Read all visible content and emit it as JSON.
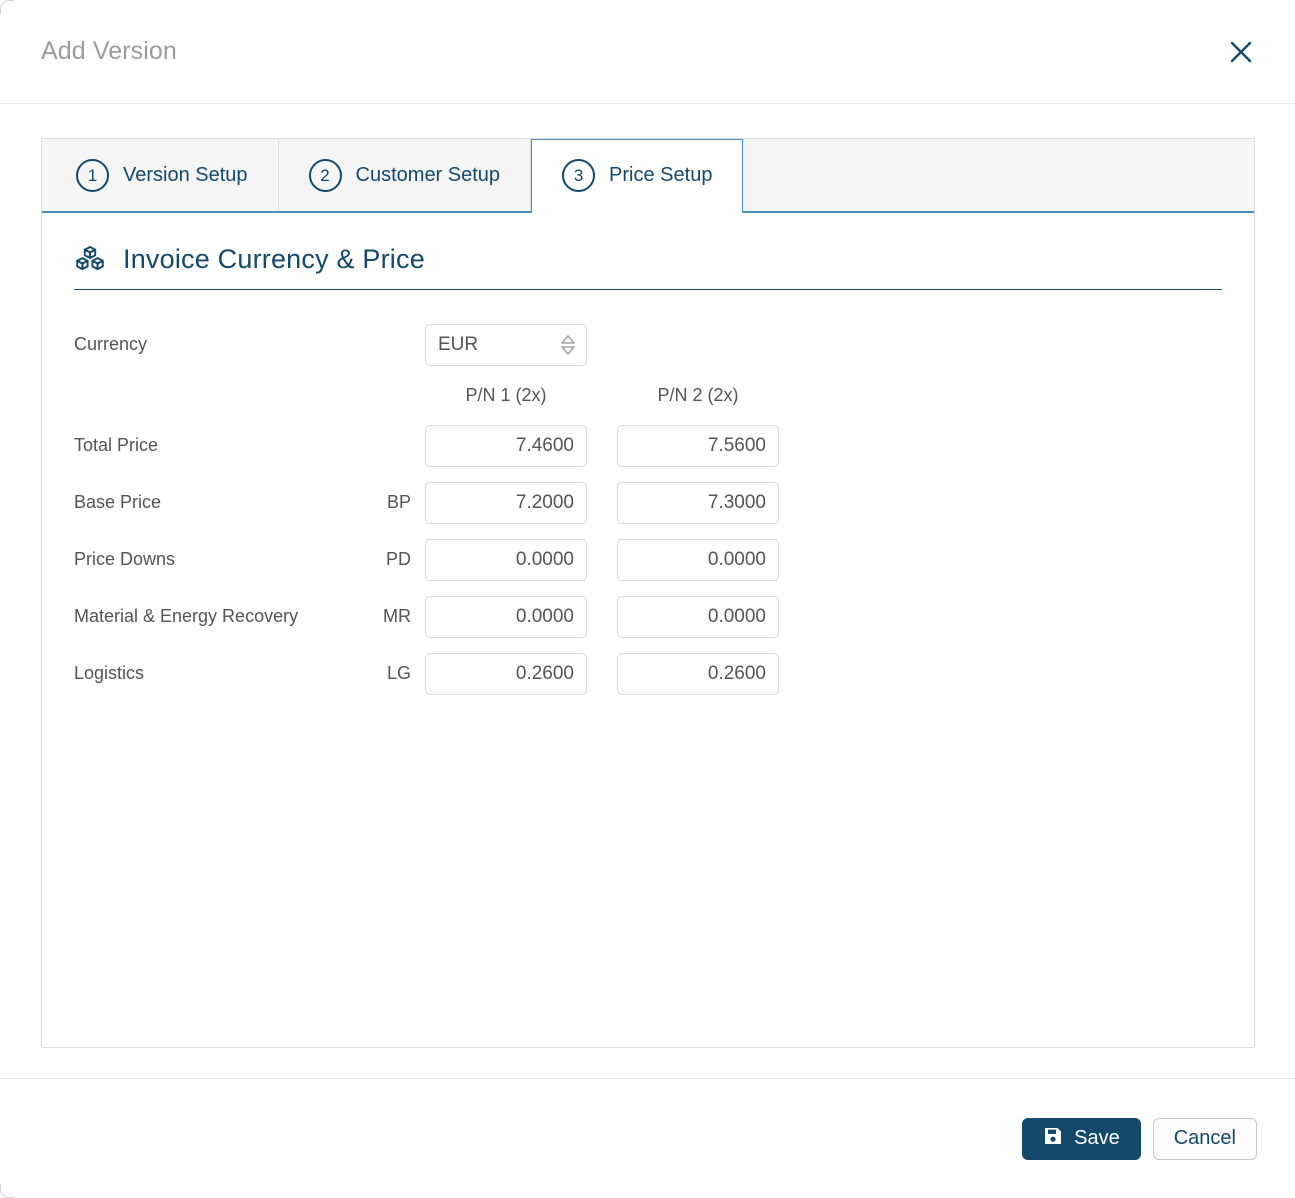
{
  "dialog": {
    "title": "Add Version",
    "close_icon": "close-icon"
  },
  "tabs": [
    {
      "number": "1",
      "label": "Version Setup",
      "active": false
    },
    {
      "number": "2",
      "label": "Customer Setup",
      "active": false
    },
    {
      "number": "3",
      "label": "Price Setup",
      "active": true
    }
  ],
  "section": {
    "icon": "boxes-icon",
    "title": "Invoice Currency & Price"
  },
  "currency": {
    "label": "Currency",
    "value": "EUR",
    "stepper_icon": "up-down-stepper-icon"
  },
  "columns": [
    {
      "header": "P/N 1 (2x)"
    },
    {
      "header": "P/N 2 (2x)"
    }
  ],
  "rows": [
    {
      "label": "Total Price",
      "code": "",
      "values": [
        "7.4600",
        "7.5600"
      ]
    },
    {
      "label": "Base Price",
      "code": "BP",
      "values": [
        "7.2000",
        "7.3000"
      ]
    },
    {
      "label": "Price Downs",
      "code": "PD",
      "values": [
        "0.0000",
        "0.0000"
      ]
    },
    {
      "label": "Material & Energy Recovery",
      "code": "MR",
      "values": [
        "0.0000",
        "0.0000"
      ]
    },
    {
      "label": "Logistics",
      "code": "LG",
      "values": [
        "0.2600",
        "0.2600"
      ]
    }
  ],
  "footer": {
    "save_label": "Save",
    "save_icon": "floppy-disk-save-icon",
    "cancel_label": "Cancel"
  },
  "colors": {
    "brand_dark_blue": "#13496b",
    "tab_border_blue": "#4a90c4",
    "title_gray": "#9e9c96",
    "label_gray": "#56544f",
    "field_border": "#dcdcdc",
    "tabstrip_bg": "#f5f5f5"
  }
}
